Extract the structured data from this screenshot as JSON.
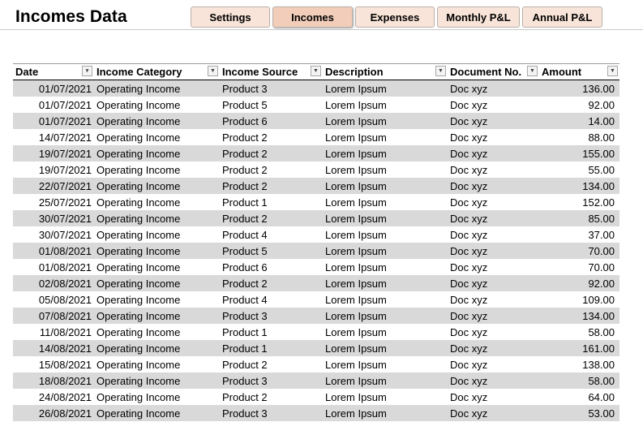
{
  "page_title": "Incomes Data",
  "tabs": [
    {
      "label": "Settings"
    },
    {
      "label": "Incomes"
    },
    {
      "label": "Expenses"
    },
    {
      "label": "Monthly P&L"
    },
    {
      "label": "Annual P&L"
    }
  ],
  "active_tab": "Incomes",
  "table": {
    "columns": [
      "Date",
      "Income Category",
      "Income Source",
      "Description",
      "Document No.",
      "Amount"
    ],
    "rows": [
      [
        "01/07/2021",
        "Operating Income",
        "Product 3",
        "Lorem Ipsum",
        "Doc xyz",
        "136.00"
      ],
      [
        "01/07/2021",
        "Operating Income",
        "Product 5",
        "Lorem Ipsum",
        "Doc xyz",
        "92.00"
      ],
      [
        "01/07/2021",
        "Operating Income",
        "Product 6",
        "Lorem Ipsum",
        "Doc xyz",
        "14.00"
      ],
      [
        "14/07/2021",
        "Operating Income",
        "Product 2",
        "Lorem Ipsum",
        "Doc xyz",
        "88.00"
      ],
      [
        "19/07/2021",
        "Operating Income",
        "Product 2",
        "Lorem Ipsum",
        "Doc xyz",
        "155.00"
      ],
      [
        "19/07/2021",
        "Operating Income",
        "Product 2",
        "Lorem Ipsum",
        "Doc xyz",
        "55.00"
      ],
      [
        "22/07/2021",
        "Operating Income",
        "Product 2",
        "Lorem Ipsum",
        "Doc xyz",
        "134.00"
      ],
      [
        "25/07/2021",
        "Operating Income",
        "Product 1",
        "Lorem Ipsum",
        "Doc xyz",
        "152.00"
      ],
      [
        "30/07/2021",
        "Operating Income",
        "Product 2",
        "Lorem Ipsum",
        "Doc xyz",
        "85.00"
      ],
      [
        "30/07/2021",
        "Operating Income",
        "Product 4",
        "Lorem Ipsum",
        "Doc xyz",
        "37.00"
      ],
      [
        "01/08/2021",
        "Operating Income",
        "Product 5",
        "Lorem Ipsum",
        "Doc xyz",
        "70.00"
      ],
      [
        "01/08/2021",
        "Operating Income",
        "Product 6",
        "Lorem Ipsum",
        "Doc xyz",
        "70.00"
      ],
      [
        "02/08/2021",
        "Operating Income",
        "Product 2",
        "Lorem Ipsum",
        "Doc xyz",
        "92.00"
      ],
      [
        "05/08/2021",
        "Operating Income",
        "Product 4",
        "Lorem Ipsum",
        "Doc xyz",
        "109.00"
      ],
      [
        "07/08/2021",
        "Operating Income",
        "Product 3",
        "Lorem Ipsum",
        "Doc xyz",
        "134.00"
      ],
      [
        "11/08/2021",
        "Operating Income",
        "Product 1",
        "Lorem Ipsum",
        "Doc xyz",
        "58.00"
      ],
      [
        "14/08/2021",
        "Operating Income",
        "Product 1",
        "Lorem Ipsum",
        "Doc xyz",
        "161.00"
      ],
      [
        "15/08/2021",
        "Operating Income",
        "Product 2",
        "Lorem Ipsum",
        "Doc xyz",
        "138.00"
      ],
      [
        "18/08/2021",
        "Operating Income",
        "Product 3",
        "Lorem Ipsum",
        "Doc xyz",
        "58.00"
      ],
      [
        "24/08/2021",
        "Operating Income",
        "Product 2",
        "Lorem Ipsum",
        "Doc xyz",
        "64.00"
      ],
      [
        "26/08/2021",
        "Operating Income",
        "Product 3",
        "Lorem Ipsum",
        "Doc xyz",
        "53.00"
      ]
    ]
  },
  "icons": {
    "sorted_filter": "sort-ascending-filter-icon",
    "filter": "filter-dropdown-icon"
  },
  "colors": {
    "tab_bg": "#f8e4d8",
    "tab_active_bg": "#f2cdb9",
    "band_row": "#d9d9d9"
  }
}
